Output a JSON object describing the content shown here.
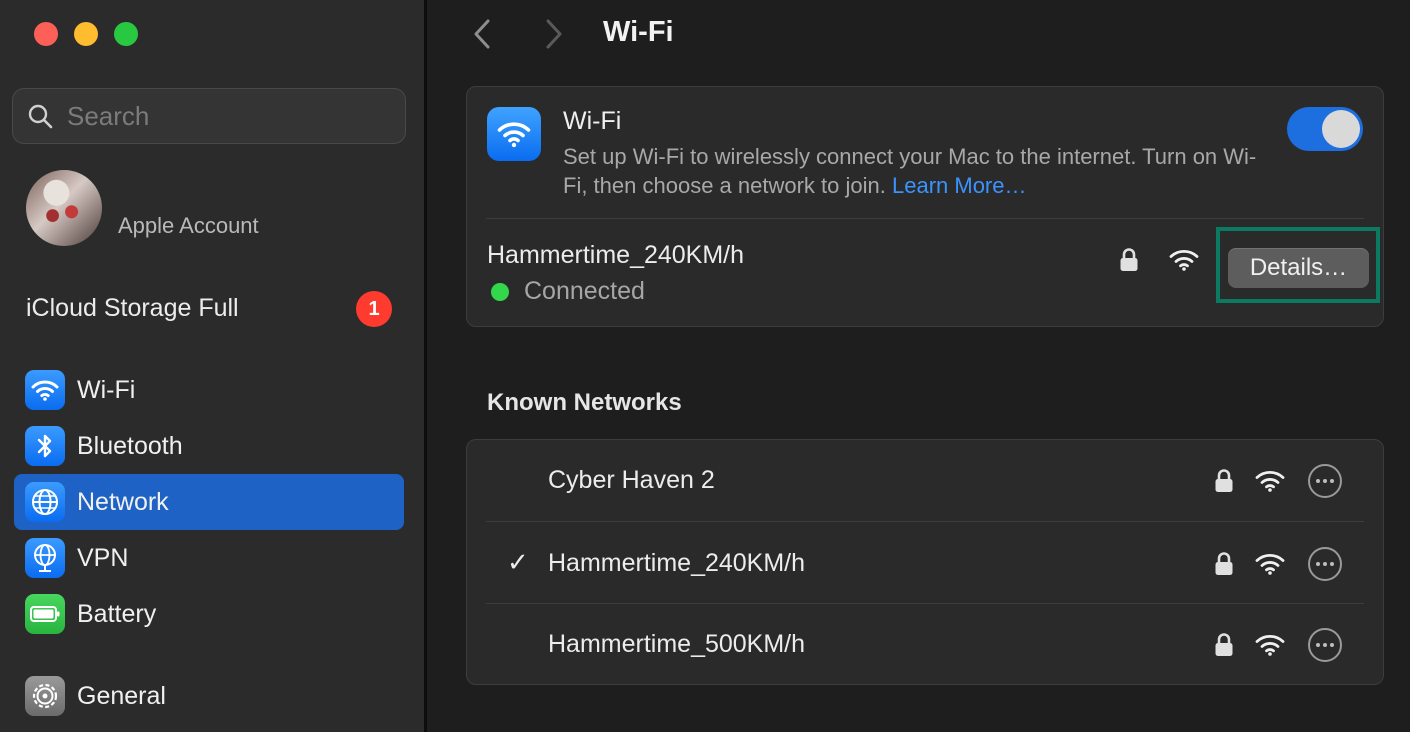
{
  "window": {
    "title": "Wi-Fi"
  },
  "sidebar": {
    "search_placeholder": "Search",
    "account_label": "Apple Account",
    "icloud_label": "iCloud Storage Full",
    "icloud_badge": "1",
    "items": [
      {
        "label": "Wi-Fi",
        "icon": "wifi-icon",
        "active": false
      },
      {
        "label": "Bluetooth",
        "icon": "bluetooth-icon",
        "active": false
      },
      {
        "label": "Network",
        "icon": "globe-icon",
        "active": true
      },
      {
        "label": "VPN",
        "icon": "vpn-globe-icon",
        "active": false
      },
      {
        "label": "Battery",
        "icon": "battery-icon",
        "active": false
      },
      {
        "label": "General",
        "icon": "gear-icon",
        "active": false
      }
    ]
  },
  "wifi_card": {
    "title": "Wi-Fi",
    "description": "Set up Wi-Fi to wirelessly connect your Mac to the internet. Turn on Wi-Fi, then choose a network to join.",
    "learn_more": "Learn More…",
    "enabled": true,
    "current_network": "Hammertime_240KM/h",
    "status": "Connected",
    "details_button": "Details…"
  },
  "known_networks": {
    "heading": "Known Networks",
    "items": [
      {
        "name": "Cyber Haven 2",
        "connected": false
      },
      {
        "name": "Hammertime_240KM/h",
        "connected": true,
        "check": "✓"
      },
      {
        "name": "Hammertime_500KM/h",
        "connected": false
      }
    ]
  },
  "colors": {
    "accent": "#1d62c4",
    "toggle_on": "#1d6fe0",
    "status_green": "#32d74b",
    "badge_red": "#ff3b30",
    "highlight_frame": "#0c7a60",
    "link": "#3a93ff"
  }
}
